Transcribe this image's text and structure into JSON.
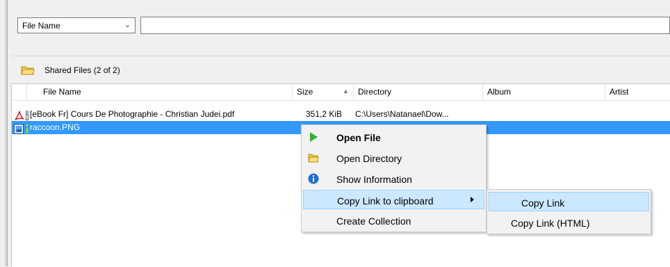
{
  "filter": {
    "field_selected": "File Name",
    "query_value": ""
  },
  "shared": {
    "title": "Shared Files (2 of 2)"
  },
  "columns": [
    "File Name",
    "Size",
    "Directory",
    "Album",
    "Artist"
  ],
  "rows": [
    {
      "name": "[eBook Fr] Cours De Photographie - Christian Judei.pdf",
      "size": "351,2 KiB",
      "directory": "C:\\Users\\Natanael\\Dow...",
      "icon": "pdf-icon"
    },
    {
      "name": "raccoon.PNG",
      "size": "",
      "directory": "",
      "icon": "image-file-icon"
    }
  ],
  "context_menu": {
    "items": [
      {
        "label": "Open File",
        "icon": "play-icon",
        "bold": true
      },
      {
        "label": "Open Directory",
        "icon": "folder-icon"
      },
      {
        "label": "Show Information",
        "icon": "info-icon"
      },
      {
        "label": "Copy Link to clipboard",
        "icon": "",
        "has_submenu": true
      },
      {
        "label": "Create Collection",
        "icon": ""
      }
    ]
  },
  "submenu": {
    "items": [
      {
        "label": "Copy Link"
      },
      {
        "label": "Copy Link (HTML)"
      }
    ]
  },
  "colors": {
    "selection": "#3399ff",
    "menu_hover": "#cce8ff",
    "play_green": "#2db52d",
    "info_blue": "#1f6fd1",
    "folder_yellow": "#f3c946",
    "pdf_red": "#d32f2f"
  }
}
